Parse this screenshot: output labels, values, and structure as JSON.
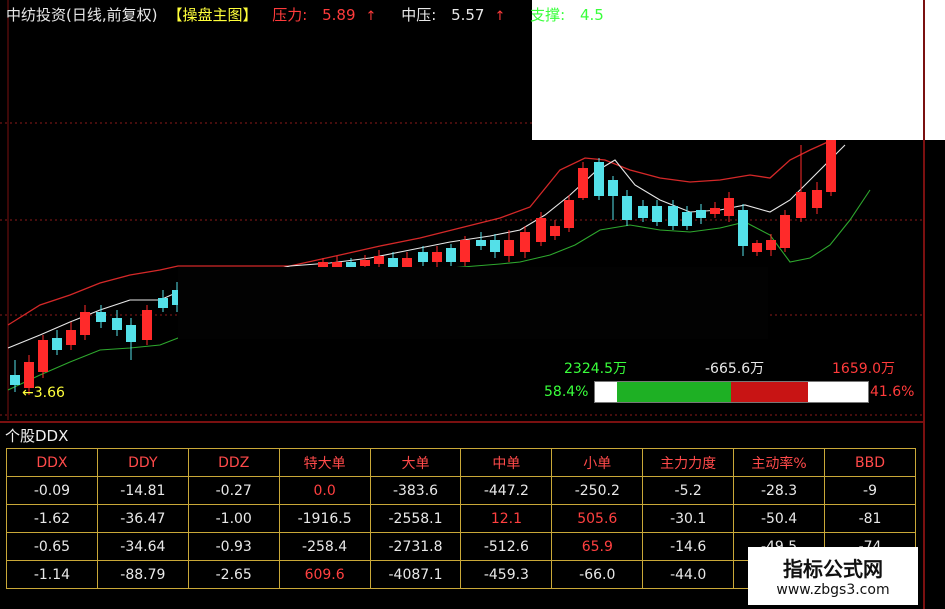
{
  "header": {
    "stock_name": "中纺投资(日线,前复权)",
    "indicator": "【操盘主图】",
    "resistance_label": "压力:",
    "resistance_value": "5.89",
    "mid_label": "中压:",
    "mid_value": "5.57",
    "support_label": "支撑:",
    "support_value": "4.5",
    "arrow_up": "↑"
  },
  "chart": {
    "low_marker": "←3.66",
    "colors": {
      "up": "#ff2a2a",
      "down": "#54e0e8",
      "upper_band": "#d42828",
      "lower_band": "#2ea82e",
      "mid_line": "#e8e8e8"
    }
  },
  "flow": {
    "value_1": "2324.5万",
    "value_2": "-665.6万",
    "value_3": "1659.0万",
    "left_pct": "58.4%",
    "right_pct": "41.6%",
    "segments": [
      {
        "color": "#ffffff",
        "fraction": 0.08
      },
      {
        "color": "#1eb024",
        "fraction": 0.42
      },
      {
        "color": "#c81414",
        "fraction": 0.28
      },
      {
        "color": "#ffffff",
        "fraction": 0.22
      }
    ]
  },
  "ddx": {
    "title": "个股DDX",
    "columns": [
      "DDX",
      "DDY",
      "DDZ",
      "特大单",
      "大单",
      "中单",
      "小单",
      "主力力度",
      "主动率%",
      "BBD"
    ],
    "rows": [
      [
        "-0.09",
        "-14.81",
        "-0.27",
        "0.0",
        "-383.6",
        "-447.2",
        "-250.2",
        "-5.2",
        "-28.3",
        "-9"
      ],
      [
        "-1.62",
        "-36.47",
        "-1.00",
        "-1916.5",
        "-2558.1",
        "12.1",
        "505.6",
        "-30.1",
        "-50.4",
        "-81"
      ],
      [
        "-0.65",
        "-34.64",
        "-0.93",
        "-258.4",
        "-2731.8",
        "-512.6",
        "65.9",
        "-14.6",
        "-49.5",
        "-74"
      ],
      [
        "-1.14",
        "-88.79",
        "-2.65",
        "609.6",
        "-4087.1",
        "-459.3",
        "-66.0",
        "-44.0",
        "",
        ""
      ]
    ],
    "red_cells": [
      [
        0,
        3
      ],
      [
        1,
        5
      ],
      [
        1,
        6
      ],
      [
        2,
        6
      ],
      [
        3,
        3
      ]
    ]
  },
  "watermark": {
    "title": "指标公式网",
    "url": "www.zbgs3.com"
  }
}
